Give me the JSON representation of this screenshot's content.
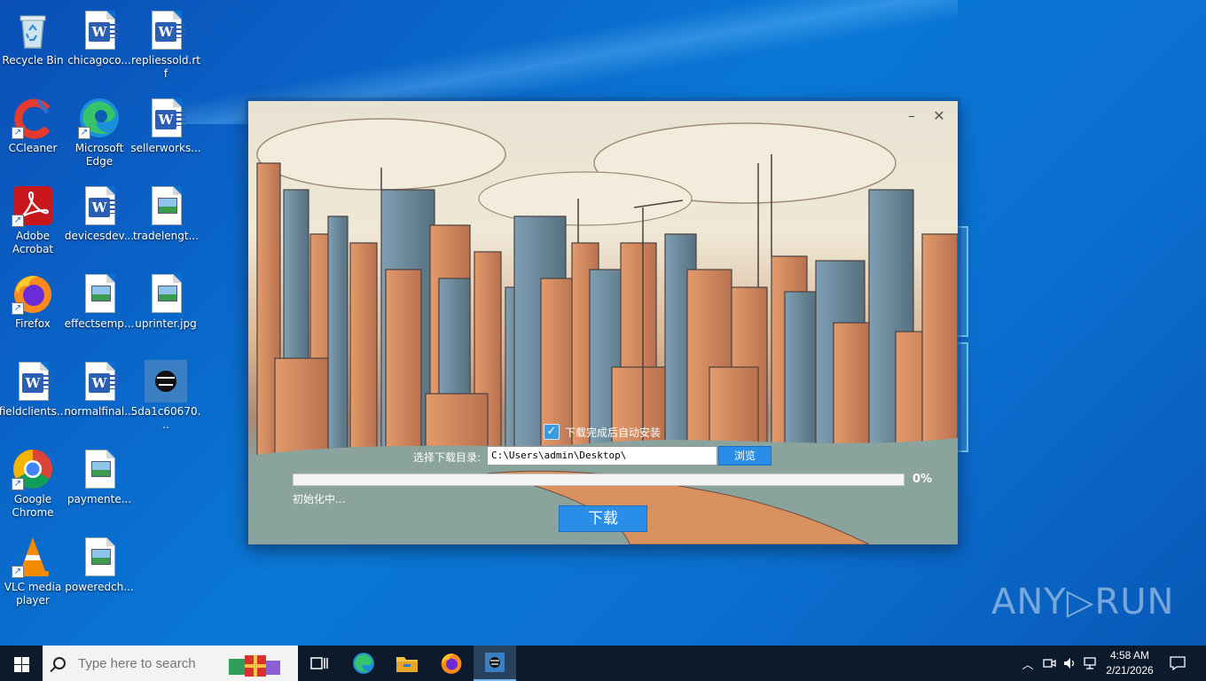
{
  "desktop": {
    "icons": [
      {
        "label": "Recycle Bin",
        "icon": "recycle-bin-icon"
      },
      {
        "label": "chicagoco...",
        "icon": "word-doc-icon"
      },
      {
        "label": "repliessold.rtf",
        "icon": "word-doc-icon"
      },
      {
        "label": "CCleaner",
        "icon": "ccleaner-icon"
      },
      {
        "label": "Microsoft Edge",
        "icon": "edge-icon"
      },
      {
        "label": "sellerworks...",
        "icon": "word-doc-icon"
      },
      {
        "label": "Adobe Acrobat",
        "icon": "acrobat-icon"
      },
      {
        "label": "devicesdev...",
        "icon": "word-doc-icon"
      },
      {
        "label": "tradelengt...",
        "icon": "image-file-icon"
      },
      {
        "label": "Firefox",
        "icon": "firefox-icon"
      },
      {
        "label": "effectsemp...",
        "icon": "image-file-icon"
      },
      {
        "label": "uprinter.jpg",
        "icon": "image-file-icon"
      },
      {
        "label": "fieldclients...",
        "icon": "word-doc-icon"
      },
      {
        "label": "normalfinal...",
        "icon": "word-doc-icon"
      },
      {
        "label": "5da1c60670...",
        "icon": "app-thumbnail-icon"
      },
      {
        "label": "Google Chrome",
        "icon": "chrome-icon"
      },
      {
        "label": "paymente...",
        "icon": "image-file-icon"
      },
      {
        "label": "VLC media player",
        "icon": "vlc-icon"
      },
      {
        "label": "poweredch...",
        "icon": "image-file-icon"
      }
    ]
  },
  "dialog": {
    "auto_install_label": "下载完成后自动安装",
    "auto_install_checked": true,
    "dir_label": "选择下载目录:",
    "dir_value": "C:\\Users\\admin\\Desktop\\",
    "browse_label": "浏览",
    "progress_percent": 0,
    "progress_text": "0%",
    "status_text": "初始化中...",
    "download_label": "下载",
    "accent_color": "#2a8ee8"
  },
  "watermark": {
    "text": "ANY▷RUN"
  },
  "taskbar": {
    "search_placeholder": "Type here to search",
    "time": "4:58 AM",
    "date": "2/21/2026",
    "pinned": [
      "task-view-icon",
      "edge-icon",
      "file-explorer-icon",
      "firefox-icon",
      "installer-app-icon"
    ]
  }
}
